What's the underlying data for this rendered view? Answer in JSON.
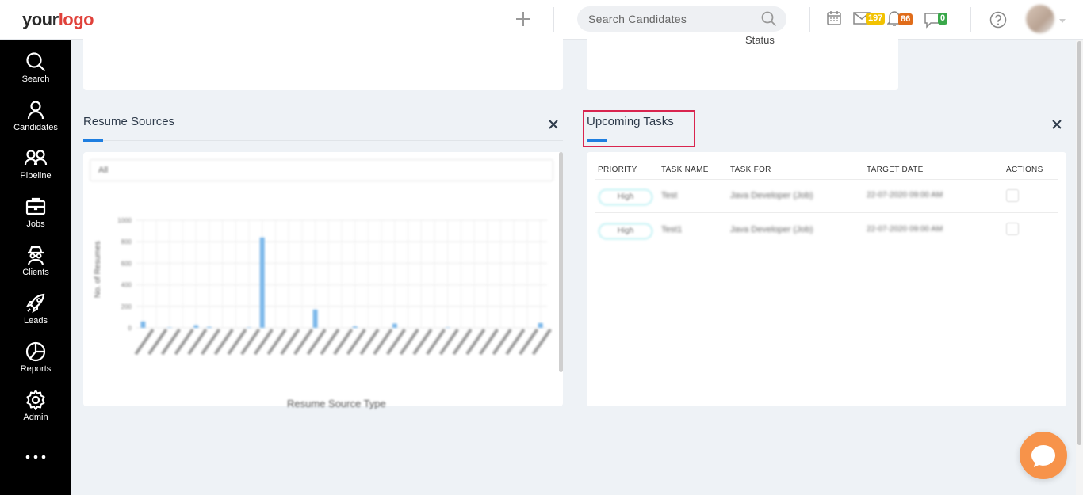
{
  "header": {
    "logo_your": "your",
    "logo_logo": "logo",
    "search_placeholder": "Search Candidates",
    "mail_badge": "197",
    "bell_badge": "86",
    "chat_badge": "0"
  },
  "sidebar": {
    "items": [
      {
        "label": "Search"
      },
      {
        "label": "Candidates"
      },
      {
        "label": "Pipeline"
      },
      {
        "label": "Jobs"
      },
      {
        "label": "Clients"
      },
      {
        "label": "Leads"
      },
      {
        "label": "Reports"
      },
      {
        "label": "Admin"
      }
    ]
  },
  "top_cards": {
    "right_label": "Status"
  },
  "resume_sources": {
    "title": "Resume Sources",
    "filter_value": "All",
    "x_axis_title": "Resume Source Type",
    "y_axis_title": "No. of Resumes"
  },
  "chart_data": {
    "type": "bar",
    "title": "",
    "xlabel": "Resume Source Type",
    "ylabel": "No. of Resumes",
    "ylim": [
      0,
      1000
    ],
    "yticks": [
      0,
      200,
      400,
      600,
      800,
      1000
    ],
    "values": [
      60,
      0,
      5,
      0,
      25,
      10,
      0,
      0,
      5,
      840,
      0,
      0,
      0,
      170,
      0,
      0,
      15,
      0,
      0,
      40,
      0,
      0,
      0,
      5,
      0,
      0,
      0,
      0,
      0,
      0,
      45
    ]
  },
  "upcoming_tasks": {
    "title": "Upcoming Tasks",
    "columns": [
      "PRIORITY",
      "TASK NAME",
      "TASK FOR",
      "TARGET DATE",
      "ACTIONS"
    ],
    "rows": [
      {
        "priority": "High",
        "task_name": "Test",
        "task_for": "Java Developer (Job)",
        "target_date": "22-07-2020 09:00 AM"
      },
      {
        "priority": "High",
        "task_name": "Test1",
        "task_for": "Java Developer (Job)",
        "target_date": "22-07-2020 09:00 AM"
      }
    ]
  },
  "colors": {
    "sidebar_bg": "#000000",
    "accent_blue": "#1e7ee0",
    "highlight_red": "#d9254f",
    "chat_orange": "#f7934a",
    "logo_red": "#e0413a"
  }
}
